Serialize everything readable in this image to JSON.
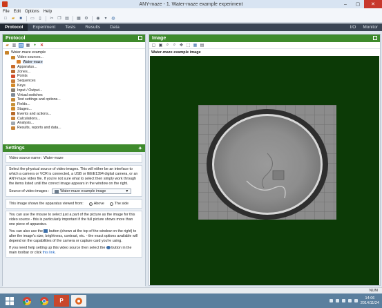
{
  "window": {
    "title": "ANY-maze - 1. Water-maze example experiment",
    "min": "–",
    "max": "▢",
    "close": "✕"
  },
  "menu": [
    "File",
    "Edit",
    "Options",
    "Help"
  ],
  "tabs": [
    "Protocol",
    "Experiment",
    "Tests",
    "Results",
    "Data"
  ],
  "tabs_right": [
    "I/O",
    "Monitor"
  ],
  "protocol": {
    "header": "Protocol",
    "tree": [
      {
        "label": "Water-maze example",
        "level": 0,
        "color": "#c8832a"
      },
      {
        "label": "Video sources...",
        "level": 1,
        "color": "#c8832a"
      },
      {
        "label": "Water-maze",
        "level": 2,
        "color": "#d9802a",
        "selected": true
      },
      {
        "label": "Apparatus...",
        "level": 1,
        "color": "#c86a2a"
      },
      {
        "label": "Zones...",
        "level": 1,
        "color": "#b9692f"
      },
      {
        "label": "Points",
        "level": 1,
        "color": "#d44b2b"
      },
      {
        "label": "Sequences",
        "level": 1,
        "color": "#c77d3a"
      },
      {
        "label": "Keys",
        "level": 1,
        "color": "#d48a2a"
      },
      {
        "label": "Input / Output...",
        "level": 1,
        "color": "#8a7f70"
      },
      {
        "label": "Virtual switches",
        "level": 1,
        "color": "#7f8a96"
      },
      {
        "label": "Test settings and options...",
        "level": 1,
        "color": "#c48a3a"
      },
      {
        "label": "Fields...",
        "level": 1,
        "color": "#c6923a"
      },
      {
        "label": "Stages...",
        "level": 1,
        "color": "#cf8a2a"
      },
      {
        "label": "Events and actions...",
        "level": 1,
        "color": "#b66a2a"
      },
      {
        "label": "Calculations...",
        "level": 1,
        "color": "#c8833a"
      },
      {
        "label": "Analysis...",
        "level": 1,
        "color": "#a0a8b0"
      },
      {
        "label": "Results, reports and data...",
        "level": 1,
        "color": "#c7843a"
      }
    ]
  },
  "settings": {
    "header": "Settings",
    "name_label": "Video source name",
    "name_sep": ":",
    "name_value": "Water-maze",
    "description": "Select the physical source of video images. This will either be an interface to which a camera or VCR is connected, a USB or IEEE1394 digital camera, or an ANY-maze video file. If you're not sure what to select then simply work through the items listed until the correct image appears in the window on the right.",
    "source_label": "Source of video images :",
    "source_value": "Water-maze example image",
    "viewed_label": "This image shows the apparatus viewed from:",
    "radio_above": "Above",
    "radio_side": "The side",
    "help1": "You can use the mouse to select just a part of the picture as the image for this video source - this is particularly important if the full picture shows more than one piece of apparatus.",
    "help2_a": "You can also use the",
    "help2_b": "button (shown at the top of the window on the right) to alter the image's size, brightness, contrast, etc. - the exact options available will depend on the capabilities of the camera or capture card you're using.",
    "help3_a": "If you need help setting up this video source then select the",
    "help3_b": "button in the main toolbar or click",
    "help3_link": "this link",
    "help3_end": "."
  },
  "image_panel": {
    "header": "Image",
    "caption": "Water-maze example image"
  },
  "statusbar": {
    "num": "NUM"
  },
  "taskbar": {
    "time": "14:06",
    "date": "2014/11/24"
  }
}
